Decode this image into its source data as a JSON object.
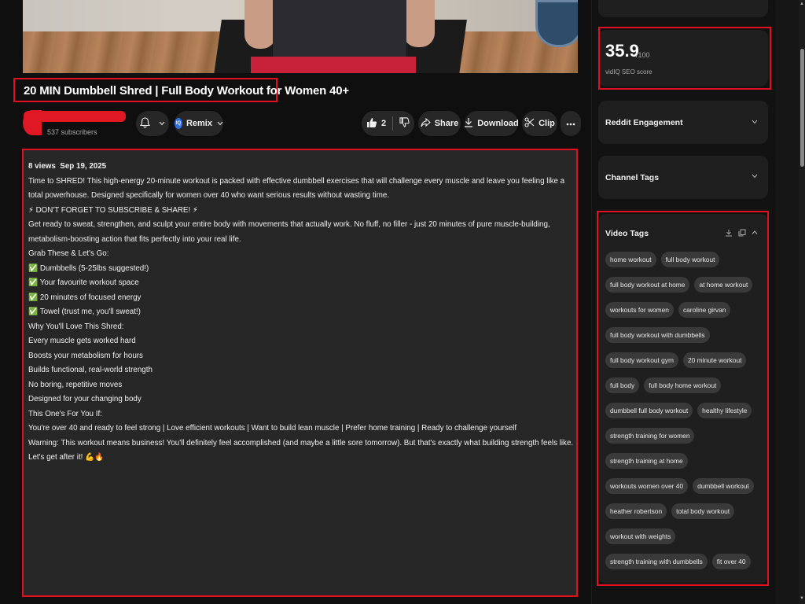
{
  "video": {
    "title": "20 MIN Dumbbell Shred | Full Body Workout for Women 40+"
  },
  "channel": {
    "subscribers": "537 subscribers"
  },
  "actions": {
    "remix_label": "Remix",
    "iq_badge": "IQ",
    "like_count": "2",
    "share_label": "Share",
    "download_label": "Download",
    "clip_label": "Clip"
  },
  "description": {
    "meta": "8 views  Sep 19, 2025",
    "lines": [
      "Time to SHRED! This high-energy 20-minute workout is packed with effective dumbbell exercises that will challenge every muscle and leave you feeling like a total powerhouse. Designed specifically for women over 40 who want serious results without wasting time.",
      "",
      "⚡ DON'T FORGET TO SUBSCRIBE & SHARE! ⚡",
      "",
      "Get ready to sweat, strengthen, and sculpt your entire body with movements that actually work. No fluff, no filler - just 20 minutes of pure muscle-building, metabolism-boosting action that fits perfectly into your real life.",
      "",
      "Grab These & Let's Go:",
      "",
      "✅ Dumbbells (5-25lbs suggested!)",
      "✅ Your favourite workout space",
      "✅ 20 minutes of focused energy",
      "✅ Towel (trust me, you'll sweat!)",
      "",
      "Why You'll Love This Shred:",
      "",
      "Every muscle gets worked hard",
      "Boosts your metabolism for hours",
      "Builds functional, real-world strength",
      "No boring, repetitive moves",
      "Designed for your changing body",
      "",
      "This One's For You If:",
      "",
      "You're over 40 and ready to feel strong | Love efficient workouts | Want to build lean muscle | Prefer home training | Ready to challenge yourself",
      "Warning: This workout means business! You'll definitely feel accomplished (and maybe a little sore tomorrow). But that's exactly what building strength feels like.",
      "",
      "Let's get after it! 💪🔥"
    ]
  },
  "sidebar": {
    "seo_score": "35.9",
    "seo_of": "/100",
    "seo_label": "vidIQ SEO score",
    "reddit_title": "Reddit Engagement",
    "channel_tags_title": "Channel Tags",
    "video_tags_title": "Video Tags",
    "tags": [
      "home workout",
      "full body workout",
      "full body workout at home",
      "at home workout",
      "workouts for women",
      "caroline girvan",
      "full body workout with dumbbells",
      "full body workout gym",
      "20 minute workout",
      "full body",
      "full body home workout",
      "dumbbell full body workout",
      "healthy lifestyle",
      "strength training for women",
      "strength training at home",
      "workouts women over 40",
      "dumbbell workout",
      "heather robertson",
      "total body workout",
      "workout with weights",
      "strength training with dumbbells",
      "fit over 40"
    ]
  },
  "icons": {
    "bell": "bell-icon",
    "like": "thumbs-up-icon",
    "dislike": "thumbs-down-icon",
    "share": "share-icon",
    "download": "download-icon",
    "clip": "scissors-icon",
    "more": "more-icon"
  },
  "colors": {
    "highlight": "#e0101e",
    "background": "#0f0f0f",
    "card": "#1f1f1f",
    "tag": "#3a3a3a"
  }
}
